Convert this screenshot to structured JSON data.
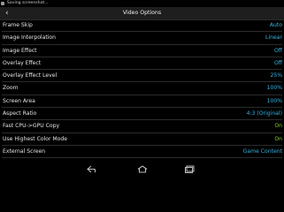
{
  "statusbar": {
    "notification_text": "Saving screenshot..."
  },
  "header": {
    "title": "Video Options",
    "back_icon": "back-arrow-icon"
  },
  "settings": [
    {
      "label": "Frame Skip",
      "value": "Auto",
      "color": "#33b5e5"
    },
    {
      "label": "Image Interpolation",
      "value": "Linear",
      "color": "#33b5e5"
    },
    {
      "label": "Image Effect",
      "value": "Off",
      "color": "#33b5e5"
    },
    {
      "label": "Overlay Effect",
      "value": "Off",
      "color": "#33b5e5"
    },
    {
      "label": "Overlay Effect Level",
      "value": "25%",
      "color": "#33b5e5"
    },
    {
      "label": "Zoom",
      "value": "100%",
      "color": "#33b5e5"
    },
    {
      "label": "Screen Area",
      "value": "100%",
      "color": "#33b5e5"
    },
    {
      "label": "Aspect Ratio",
      "value": "4:3 (Original)",
      "color": "#33b5e5"
    },
    {
      "label": "Fast CPU->GPU Copy",
      "value": "On",
      "color": "#7ed321"
    },
    {
      "label": "Use Highest Color Mode",
      "value": "On",
      "color": "#7ed321"
    },
    {
      "label": "External Screen",
      "value": "Game Content",
      "color": "#33b5e5"
    }
  ],
  "navbar": {
    "icons": [
      "back-icon",
      "home-icon",
      "recents-icon"
    ]
  }
}
